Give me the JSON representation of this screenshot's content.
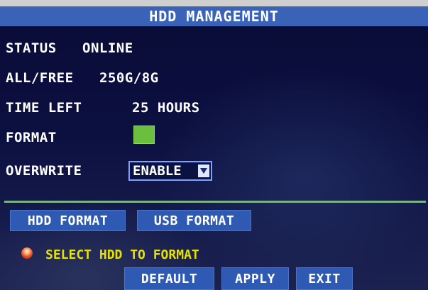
{
  "title": "HDD MANAGEMENT",
  "fields": {
    "status": {
      "label": "STATUS",
      "value": "ONLINE"
    },
    "all_free": {
      "label": "ALL/FREE",
      "value": "250G/8G"
    },
    "time_left": {
      "label": "TIME LEFT",
      "value": "25 HOURS"
    },
    "format": {
      "label": "FORMAT",
      "checked": true
    },
    "overwrite": {
      "label": "OVERWRITE",
      "value": "ENABLE"
    }
  },
  "buttons": {
    "hdd_format": "HDD FORMAT",
    "usb_format": "USB FORMAT",
    "default": "DEFAULT",
    "apply": "APPLY",
    "exit": "EXIT"
  },
  "hint": "SELECT HDD TO FORMAT",
  "colors": {
    "title_bar": "#3a63b7",
    "button": "#2f5ab3",
    "checkbox": "#6bbf3f",
    "divider": "#64c84a",
    "hint_text": "#e6e100",
    "background": "#0b0d33"
  }
}
